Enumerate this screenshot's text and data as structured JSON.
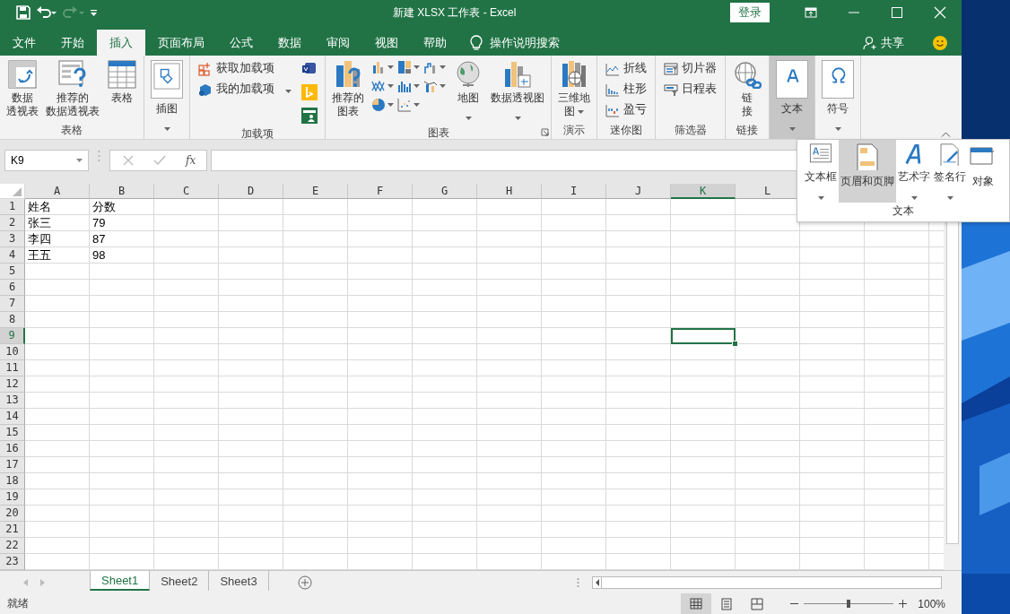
{
  "window": {
    "title": "新建 XLSX 工作表  -  Excel",
    "login_button": "登录"
  },
  "tabs": [
    {
      "label": "文件",
      "selected": false
    },
    {
      "label": "开始",
      "selected": false
    },
    {
      "label": "插入",
      "selected": true
    },
    {
      "label": "页面布局",
      "selected": false
    },
    {
      "label": "公式",
      "selected": false
    },
    {
      "label": "数据",
      "selected": false
    },
    {
      "label": "审阅",
      "selected": false
    },
    {
      "label": "视图",
      "selected": false
    },
    {
      "label": "帮助",
      "selected": false
    }
  ],
  "tell_me": "操作说明搜索",
  "share_button": "共享",
  "ribbon": {
    "groups": [
      {
        "label": "表格",
        "expanded": false,
        "launcher": false,
        "items": [
          {
            "kind": "large",
            "lines": [
              "数据",
              "透视表"
            ],
            "dropdown": false
          },
          {
            "kind": "large",
            "lines": [
              "推荐的",
              "数据透视表"
            ],
            "dropdown": false
          },
          {
            "kind": "large",
            "lines": [
              "表格"
            ],
            "dropdown": false
          }
        ]
      },
      {
        "expanded": false,
        "launcher": false,
        "items": [
          {
            "kind": "boxed",
            "lines": [
              "插图"
            ],
            "dropdown": true
          }
        ]
      },
      {
        "label": "加载项",
        "expanded": false,
        "launcher": false,
        "items": [
          {
            "kind": "small",
            "lines": [
              "获取加载项"
            ],
            "dropdown": false
          },
          {
            "kind": "small",
            "lines": [
              "我的加载项"
            ],
            "dropdown": true
          },
          {
            "kind": "icons"
          }
        ]
      },
      {
        "label": "图表",
        "expanded": false,
        "launcher": true,
        "items": [
          {
            "kind": "large",
            "lines": [
              "推荐的",
              "图表"
            ],
            "dropdown": false
          },
          {
            "kind": "chartgrid"
          },
          {
            "kind": "large",
            "lines": [
              "地图"
            ],
            "dropdown": true
          },
          {
            "kind": "large",
            "lines": [
              "数据透视图"
            ],
            "dropdown": true
          }
        ]
      },
      {
        "label": "演示",
        "expanded": false,
        "launcher": false,
        "items": [
          {
            "kind": "large",
            "lines": [
              "三维地",
              "图"
            ],
            "dropdown": true
          }
        ]
      },
      {
        "label": "迷你图",
        "expanded": false,
        "launcher": false,
        "items": [
          {
            "kind": "small",
            "lines": [
              "折线"
            ],
            "dropdown": false
          },
          {
            "kind": "small",
            "lines": [
              "柱形"
            ],
            "dropdown": false
          },
          {
            "kind": "small",
            "lines": [
              "盈亏"
            ],
            "dropdown": false
          }
        ]
      },
      {
        "label": "筛选器",
        "expanded": false,
        "launcher": false,
        "items": [
          {
            "kind": "small",
            "lines": [
              "切片器"
            ],
            "dropdown": false
          },
          {
            "kind": "small",
            "lines": [
              "日程表"
            ],
            "dropdown": false
          }
        ]
      },
      {
        "label": "链接",
        "expanded": false,
        "launcher": false,
        "items": [
          {
            "kind": "large",
            "lines": [
              "链",
              "接"
            ],
            "dropdown": false
          }
        ]
      },
      {
        "expanded": true,
        "launcher": false,
        "items": [
          {
            "kind": "boxed",
            "lines": [
              "文本"
            ],
            "dropdown": true
          }
        ]
      },
      {
        "expanded": false,
        "launcher": false,
        "items": [
          {
            "kind": "boxed",
            "lines": [
              "符号"
            ],
            "dropdown": true
          }
        ]
      }
    ]
  },
  "text_menu": {
    "label": "文本",
    "items": [
      {
        "label": "文本框",
        "caret": true,
        "selected": false
      },
      {
        "label": "页眉和页脚",
        "caret": false,
        "selected": true
      },
      {
        "label": "艺术字",
        "caret": true,
        "selected": false
      },
      {
        "label": "签名行",
        "caret": true,
        "selected": false
      },
      {
        "label": "对象",
        "caret": false,
        "selected": false
      }
    ]
  },
  "formula_bar": {
    "name_box": "K9",
    "function_label": "fx"
  },
  "sheet": {
    "columns": [
      {
        "label": "A",
        "selected": false
      },
      {
        "label": "B",
        "selected": false
      },
      {
        "label": "C",
        "selected": false
      },
      {
        "label": "D",
        "selected": false
      },
      {
        "label": "E",
        "selected": false
      },
      {
        "label": "F",
        "selected": false
      },
      {
        "label": "G",
        "selected": false
      },
      {
        "label": "H",
        "selected": false
      },
      {
        "label": "I",
        "selected": false
      },
      {
        "label": "J",
        "selected": false
      },
      {
        "label": "K",
        "selected": true
      },
      {
        "label": "L",
        "selected": false
      }
    ],
    "rows": [
      {
        "header": "1",
        "selected": false,
        "cells": [
          "姓名",
          "分数"
        ]
      },
      {
        "header": "2",
        "selected": false,
        "cells": [
          "张三",
          "79"
        ]
      },
      {
        "header": "3",
        "selected": false,
        "cells": [
          "李四",
          "87"
        ]
      },
      {
        "header": "4",
        "selected": false,
        "cells": [
          "王五",
          "98"
        ]
      },
      {
        "header": "5",
        "selected": false
      },
      {
        "header": "6",
        "selected": false
      },
      {
        "header": "7",
        "selected": false
      },
      {
        "header": "8",
        "selected": false
      },
      {
        "header": "9",
        "selected": true
      },
      {
        "header": "10",
        "selected": false
      },
      {
        "header": "11",
        "selected": false
      },
      {
        "header": "12",
        "selected": false
      },
      {
        "header": "13",
        "selected": false
      },
      {
        "header": "14",
        "selected": false
      },
      {
        "header": "15",
        "selected": false
      },
      {
        "header": "16",
        "selected": false
      },
      {
        "header": "17",
        "selected": false
      },
      {
        "header": "18",
        "selected": false
      },
      {
        "header": "19",
        "selected": false
      },
      {
        "header": "20",
        "selected": false
      },
      {
        "header": "21",
        "selected": false
      },
      {
        "header": "22",
        "selected": false
      },
      {
        "header": "23",
        "selected": false
      }
    ]
  },
  "sheet_tabs": [
    {
      "label": "Sheet1",
      "selected": true
    },
    {
      "label": "Sheet2",
      "selected": false
    },
    {
      "label": "Sheet3",
      "selected": false
    }
  ],
  "status_bar": {
    "text": "就绪",
    "views": [
      {
        "selected": true
      },
      {
        "selected": false
      },
      {
        "selected": false
      }
    ],
    "zoom": {
      "level": 0.5,
      "reading": "100%"
    }
  }
}
